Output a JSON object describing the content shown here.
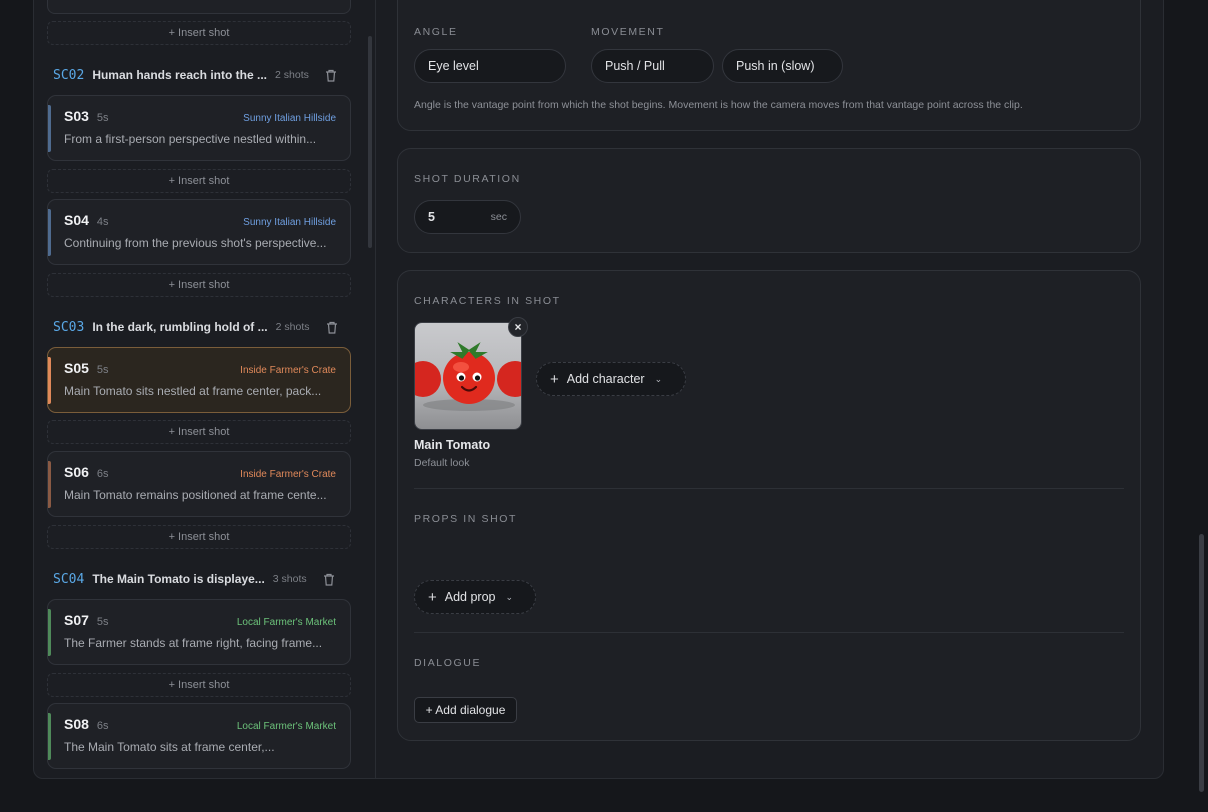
{
  "sidebar": {
    "insert_label": "+ Insert shot",
    "scenes": [
      {
        "id": "SC02",
        "title": "Human hands reach into the ...",
        "count": "2 shots"
      },
      {
        "id": "SC03",
        "title": "In the dark, rumbling hold of ...",
        "count": "2 shots"
      },
      {
        "id": "SC04",
        "title": "The Main Tomato is displaye...",
        "count": "3 shots"
      }
    ],
    "shots": [
      {
        "id": "S03",
        "duration": "5s",
        "location": "Sunny Italian Hillside",
        "location_color": "#6f9fe0",
        "edge_color": "#4f6b8f",
        "description": "From a first-person perspective nestled within..."
      },
      {
        "id": "S04",
        "duration": "4s",
        "location": "Sunny Italian Hillside",
        "location_color": "#6f9fe0",
        "edge_color": "#4f6b8f",
        "description": "Continuing from the previous shot's perspective..."
      },
      {
        "id": "S05",
        "duration": "5s",
        "location": "Inside Farmer's Crate",
        "location_color": "#e0895a",
        "edge_color": "#e0895a",
        "description": "Main Tomato sits nestled at frame center, pack..."
      },
      {
        "id": "S06",
        "duration": "6s",
        "location": "Inside Farmer's Crate",
        "location_color": "#e0895a",
        "edge_color": "#8a5a44",
        "description": "Main Tomato remains positioned at frame cente..."
      },
      {
        "id": "S07",
        "duration": "5s",
        "location": "Local Farmer's Market",
        "location_color": "#6cc27a",
        "edge_color": "#4f8a5a",
        "description": "The Farmer stands at frame right, facing frame..."
      },
      {
        "id": "S08",
        "duration": "6s",
        "location": "Local Farmer's Market",
        "location_color": "#6cc27a",
        "edge_color": "#4f8a5a",
        "description": "The Main Tomato sits at frame center,..."
      }
    ]
  },
  "camera": {
    "angle_label": "ANGLE",
    "movement_label": "MOVEMENT",
    "angle_value": "Eye level",
    "movement_values": [
      "Push / Pull",
      "Push in (slow)"
    ],
    "help_text": "Angle is the vantage point from which the shot begins. Movement is how the camera moves from that vantage point across the clip."
  },
  "duration": {
    "label": "SHOT DURATION",
    "value": "5",
    "unit": "sec"
  },
  "characters": {
    "label": "CHARACTERS IN SHOT",
    "items": [
      {
        "name": "Main Tomato",
        "look": "Default look"
      }
    ],
    "add_label": "Add character",
    "remove_glyph": "×"
  },
  "props": {
    "label": "PROPS IN SHOT",
    "add_label": "Add prop"
  },
  "dialogue": {
    "label": "DIALOGUE",
    "add_label": "+ Add dialogue"
  },
  "icons": {
    "plus": "plus-icon",
    "chevron": "chevron-down-icon",
    "trash": "trash-icon",
    "close": "close-icon"
  }
}
